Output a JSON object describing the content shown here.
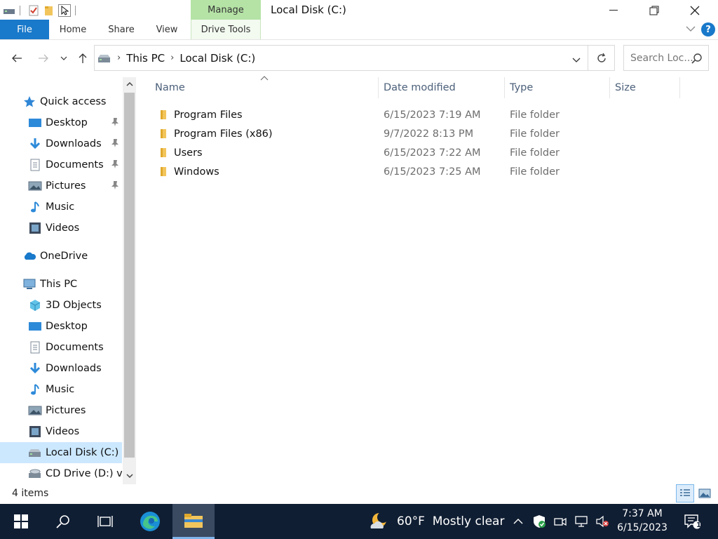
{
  "window": {
    "title": "Local Disk (C:)",
    "manage_tab": "Manage"
  },
  "ribbon": {
    "tabs": [
      "File",
      "Home",
      "Share",
      "View",
      "Drive Tools"
    ],
    "help": "?"
  },
  "address": {
    "crumbs": [
      "This PC",
      "Local Disk (C:)"
    ],
    "search_placeholder": "Search Loc..."
  },
  "nav": {
    "items": [
      {
        "label": "Quick access",
        "icon": "star-icon"
      },
      {
        "label": "Desktop",
        "icon": "desktop-icon",
        "pinned": true
      },
      {
        "label": "Downloads",
        "icon": "download-icon",
        "pinned": true
      },
      {
        "label": "Documents",
        "icon": "documents-icon",
        "pinned": true
      },
      {
        "label": "Pictures",
        "icon": "pictures-icon",
        "pinned": true
      },
      {
        "label": "Music",
        "icon": "music-icon"
      },
      {
        "label": "Videos",
        "icon": "videos-icon"
      },
      {
        "label": "OneDrive",
        "icon": "cloud-icon"
      },
      {
        "label": "This PC",
        "icon": "computer-icon"
      },
      {
        "label": "3D Objects",
        "icon": "cube-icon"
      },
      {
        "label": "Desktop",
        "icon": "desktop-icon"
      },
      {
        "label": "Documents",
        "icon": "documents-icon"
      },
      {
        "label": "Downloads",
        "icon": "download-icon"
      },
      {
        "label": "Music",
        "icon": "music-icon"
      },
      {
        "label": "Pictures",
        "icon": "pictures-icon"
      },
      {
        "label": "Videos",
        "icon": "videos-icon"
      },
      {
        "label": "Local Disk (C:)",
        "icon": "drive-icon",
        "selected": true
      },
      {
        "label": "CD Drive (D:) virt",
        "icon": "cd-drive-icon"
      }
    ]
  },
  "columns": [
    "Name",
    "Date modified",
    "Type",
    "Size"
  ],
  "files": [
    {
      "name": "Program Files",
      "date": "6/15/2023 7:19 AM",
      "type": "File folder"
    },
    {
      "name": "Program Files (x86)",
      "date": "9/7/2022 8:13 PM",
      "type": "File folder"
    },
    {
      "name": "Users",
      "date": "6/15/2023 7:22 AM",
      "type": "File folder"
    },
    {
      "name": "Windows",
      "date": "6/15/2023 7:25 AM",
      "type": "File folder"
    }
  ],
  "status": {
    "item_count": "4 items"
  },
  "taskbar": {
    "weather": "60°F  Mostly clear",
    "time": "7:37 AM",
    "date": "6/15/2023",
    "notification_count": "1"
  },
  "colors": {
    "accent": "#1979ca",
    "manage": "#b5e3a6",
    "selected": "#cce8ff",
    "folder": "#f2c55c",
    "taskbar": "#101e33"
  }
}
